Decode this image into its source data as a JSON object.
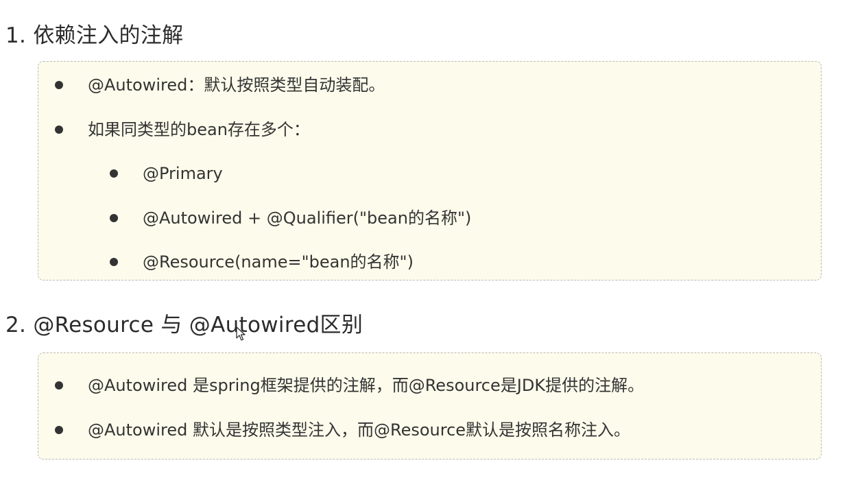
{
  "section1": {
    "heading": "1. 依赖注入的注解",
    "items": [
      {
        "text": "@Autowired：默认按照类型自动装配。"
      },
      {
        "text": "如果同类型的bean存在多个："
      },
      {
        "text": "@Primary"
      },
      {
        "text": "@Autowired + @Qualifier(\"bean的名称\")"
      },
      {
        "text": "@Resource(name=\"bean的名称\")"
      }
    ]
  },
  "section2": {
    "heading": "2. @Resource 与 @Autowired区别",
    "items": [
      {
        "text": "@Autowired 是spring框架提供的注解，而@Resource是JDK提供的注解。"
      },
      {
        "text": "@Autowired 默认是按照类型注入，而@Resource默认是按照名称注入。"
      }
    ]
  },
  "colors": {
    "box_background": "#fdfcec",
    "box_border": "#b8b8b8",
    "text": "#333333"
  },
  "icons": {
    "bullet": "filled-circle",
    "cursor": "mouse-pointer-icon"
  }
}
